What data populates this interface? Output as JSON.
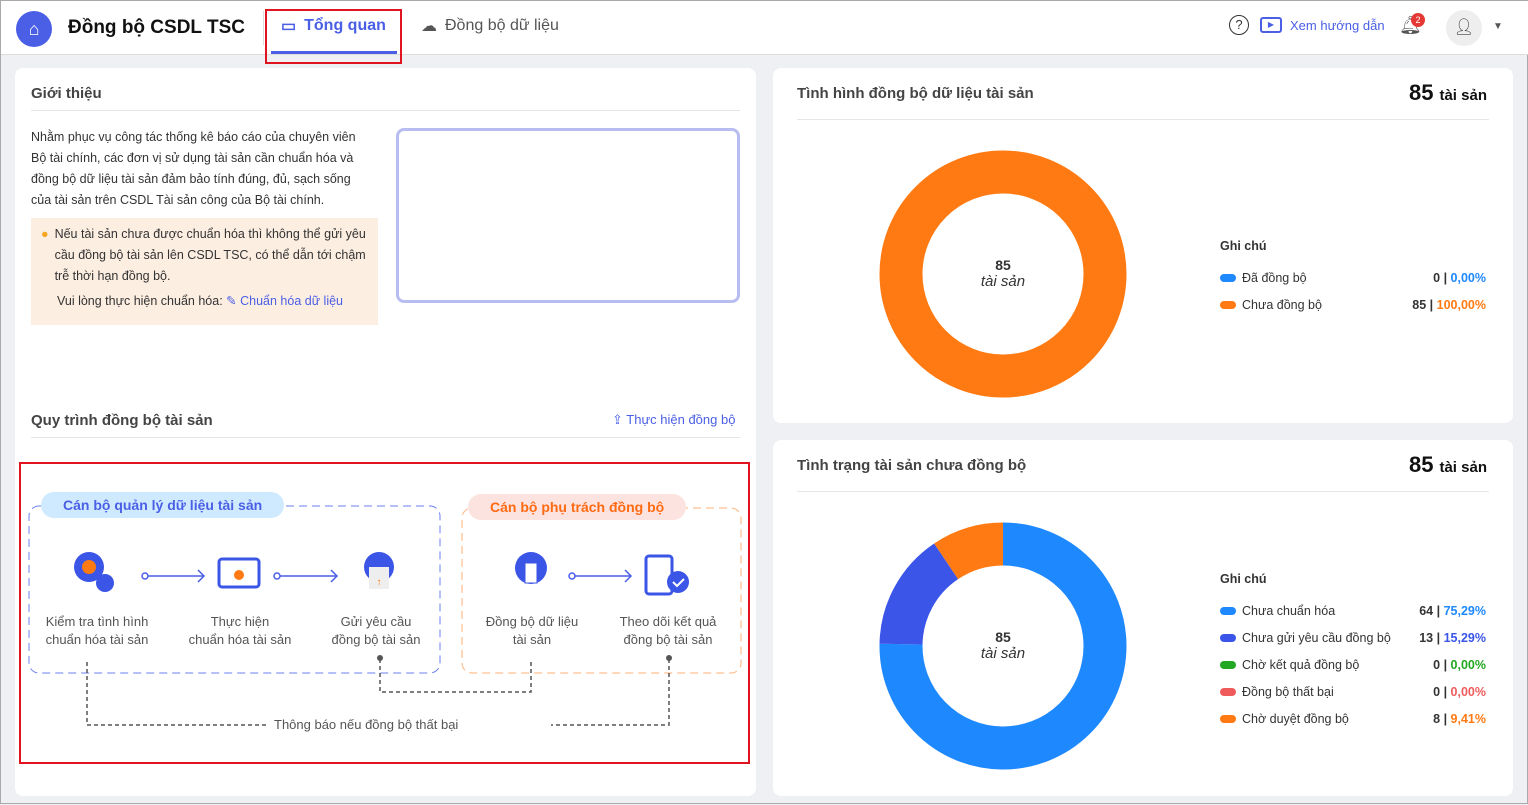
{
  "header": {
    "app_title": "Đồng bộ CSDL TSC",
    "tabs": [
      {
        "label": "Tổng quan",
        "active": true
      },
      {
        "label": "Đồng bộ dữ liệu",
        "active": false
      }
    ],
    "guide_label": "Xem hướng dẫn",
    "notification_count": "2"
  },
  "intro": {
    "title": "Giới thiệu",
    "text": "Nhằm phục vụ công tác thống kê báo cáo của chuyên viên Bộ tài chính, các đơn vị sử dụng tài sản cần chuẩn hóa và đồng bộ dữ liệu tài sản đảm bảo tính đúng, đủ, sạch sống của tài sản trên CSDL Tài sản công của Bộ tài chính.",
    "warning": "Nếu tài sản chưa được chuẩn hóa thì không thể gửi yêu cầu đồng bộ tài sản lên CSDL TSC, có thể dẫn tới chậm trễ thời hạn đồng bộ.",
    "prompt": "Vui lòng thực hiện chuẩn hóa:",
    "link": "Chuẩn hóa dữ liệu"
  },
  "process": {
    "title": "Quy trình đồng bộ tài sản",
    "action": "Thực hiện đồng bộ",
    "group1": "Cán bộ quản lý dữ liệu tài sản",
    "group2": "Cán bộ phụ trách đồng bộ",
    "steps": [
      {
        "l1": "Kiểm tra tình hình",
        "l2": "chuẩn hóa tài sản"
      },
      {
        "l1": "Thực hiện",
        "l2": "chuẩn hóa tài sản"
      },
      {
        "l1": "Gửi yêu cầu",
        "l2": "đồng bộ tài sản"
      },
      {
        "l1": "Đồng bộ dữ liệu",
        "l2": "tài sản"
      },
      {
        "l1": "Theo dõi kết quả",
        "l2": "đồng bộ tài sản"
      }
    ],
    "fail_note": "Thông báo nếu đồng bộ thất bại"
  },
  "chart_data": [
    {
      "type": "pie",
      "title": "Tình hình đồng bộ dữ liệu tài sản",
      "total": "85",
      "unit": "tài sản",
      "legend_title": "Ghi chú",
      "categories": [
        "Đã đồng bộ",
        "Chưa đồng bộ"
      ],
      "values": [
        0,
        85
      ],
      "percents": [
        "0,00%",
        "100,00%"
      ],
      "colors": [
        "#1e88ff",
        "#ff7a12"
      ]
    },
    {
      "type": "pie",
      "title": "Tình trạng tài sản chưa đồng bộ",
      "total": "85",
      "unit": "tài sản",
      "legend_title": "Ghi chú",
      "categories": [
        "Chưa chuẩn hóa",
        "Chưa gửi yêu cầu đồng bộ",
        "Chờ kết quả đồng bộ",
        "Đồng bộ thất bại",
        "Chờ duyệt đồng bộ"
      ],
      "values": [
        64,
        13,
        0,
        0,
        8
      ],
      "percents": [
        "75,29%",
        "15,29%",
        "0,00%",
        "0,00%",
        "9,41%"
      ],
      "colors": [
        "#1e88ff",
        "#3a55e8",
        "#22a822",
        "#ef5b5b",
        "#ff7a12"
      ]
    }
  ]
}
